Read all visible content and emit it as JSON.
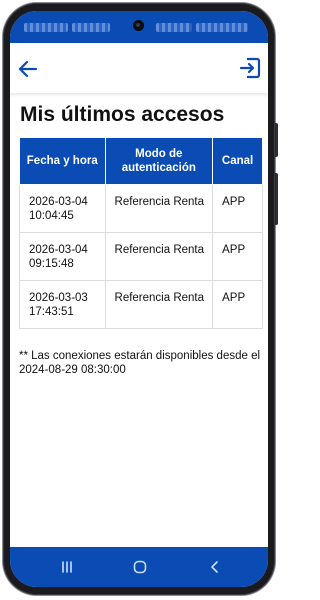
{
  "colors": {
    "primary": "#0a4bb4",
    "text": "#111111",
    "border": "#dcdcdc"
  },
  "appbar": {
    "back_icon": "arrow-left-icon",
    "logout_icon": "logout-icon"
  },
  "page": {
    "title": "Mis últimos accesos"
  },
  "table": {
    "headers": [
      "Fecha y hora",
      "Modo de autenticación",
      "Canal"
    ],
    "rows": [
      {
        "datetime": "2026-03-04 10:04:45",
        "mode": "Referencia Renta",
        "channel": "APP"
      },
      {
        "datetime": "2026-03-04 09:15:48",
        "mode": "Referencia Renta",
        "channel": "APP"
      },
      {
        "datetime": "2026-03-03 17:43:51",
        "mode": "Referencia Renta",
        "channel": "APP"
      }
    ]
  },
  "footnote": "** Las conexiones estarán disponibles desde el 2024-08-29 08:30:00",
  "navbar": {
    "recents_icon": "recents-icon",
    "home_icon": "home-icon",
    "back_icon": "nav-back-icon"
  }
}
